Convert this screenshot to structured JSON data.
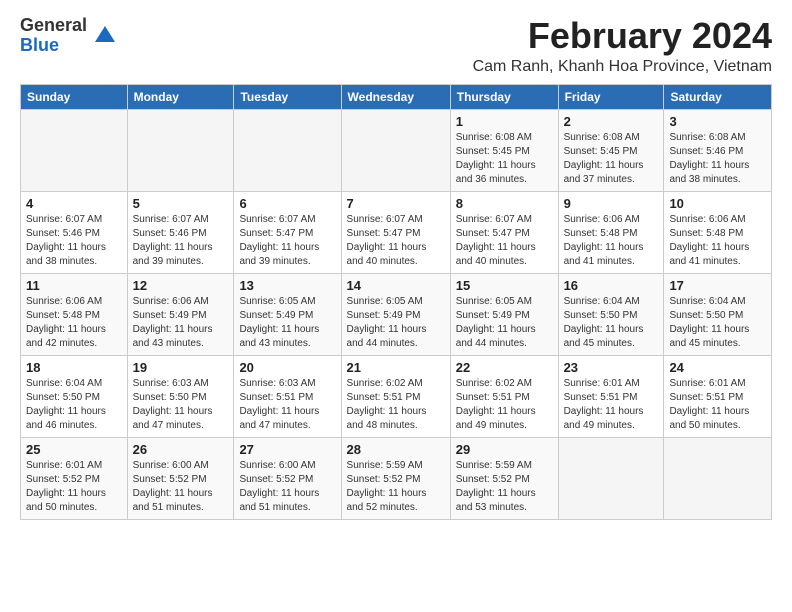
{
  "logo": {
    "general": "General",
    "blue": "Blue"
  },
  "title": "February 2024",
  "subtitle": "Cam Ranh, Khanh Hoa Province, Vietnam",
  "headers": [
    "Sunday",
    "Monday",
    "Tuesday",
    "Wednesday",
    "Thursday",
    "Friday",
    "Saturday"
  ],
  "weeks": [
    [
      {
        "day": "",
        "info": ""
      },
      {
        "day": "",
        "info": ""
      },
      {
        "day": "",
        "info": ""
      },
      {
        "day": "",
        "info": ""
      },
      {
        "day": "1",
        "info": "Sunrise: 6:08 AM\nSunset: 5:45 PM\nDaylight: 11 hours and 36 minutes."
      },
      {
        "day": "2",
        "info": "Sunrise: 6:08 AM\nSunset: 5:45 PM\nDaylight: 11 hours and 37 minutes."
      },
      {
        "day": "3",
        "info": "Sunrise: 6:08 AM\nSunset: 5:46 PM\nDaylight: 11 hours and 38 minutes."
      }
    ],
    [
      {
        "day": "4",
        "info": "Sunrise: 6:07 AM\nSunset: 5:46 PM\nDaylight: 11 hours and 38 minutes."
      },
      {
        "day": "5",
        "info": "Sunrise: 6:07 AM\nSunset: 5:46 PM\nDaylight: 11 hours and 39 minutes."
      },
      {
        "day": "6",
        "info": "Sunrise: 6:07 AM\nSunset: 5:47 PM\nDaylight: 11 hours and 39 minutes."
      },
      {
        "day": "7",
        "info": "Sunrise: 6:07 AM\nSunset: 5:47 PM\nDaylight: 11 hours and 40 minutes."
      },
      {
        "day": "8",
        "info": "Sunrise: 6:07 AM\nSunset: 5:47 PM\nDaylight: 11 hours and 40 minutes."
      },
      {
        "day": "9",
        "info": "Sunrise: 6:06 AM\nSunset: 5:48 PM\nDaylight: 11 hours and 41 minutes."
      },
      {
        "day": "10",
        "info": "Sunrise: 6:06 AM\nSunset: 5:48 PM\nDaylight: 11 hours and 41 minutes."
      }
    ],
    [
      {
        "day": "11",
        "info": "Sunrise: 6:06 AM\nSunset: 5:48 PM\nDaylight: 11 hours and 42 minutes."
      },
      {
        "day": "12",
        "info": "Sunrise: 6:06 AM\nSunset: 5:49 PM\nDaylight: 11 hours and 43 minutes."
      },
      {
        "day": "13",
        "info": "Sunrise: 6:05 AM\nSunset: 5:49 PM\nDaylight: 11 hours and 43 minutes."
      },
      {
        "day": "14",
        "info": "Sunrise: 6:05 AM\nSunset: 5:49 PM\nDaylight: 11 hours and 44 minutes."
      },
      {
        "day": "15",
        "info": "Sunrise: 6:05 AM\nSunset: 5:49 PM\nDaylight: 11 hours and 44 minutes."
      },
      {
        "day": "16",
        "info": "Sunrise: 6:04 AM\nSunset: 5:50 PM\nDaylight: 11 hours and 45 minutes."
      },
      {
        "day": "17",
        "info": "Sunrise: 6:04 AM\nSunset: 5:50 PM\nDaylight: 11 hours and 45 minutes."
      }
    ],
    [
      {
        "day": "18",
        "info": "Sunrise: 6:04 AM\nSunset: 5:50 PM\nDaylight: 11 hours and 46 minutes."
      },
      {
        "day": "19",
        "info": "Sunrise: 6:03 AM\nSunset: 5:50 PM\nDaylight: 11 hours and 47 minutes."
      },
      {
        "day": "20",
        "info": "Sunrise: 6:03 AM\nSunset: 5:51 PM\nDaylight: 11 hours and 47 minutes."
      },
      {
        "day": "21",
        "info": "Sunrise: 6:02 AM\nSunset: 5:51 PM\nDaylight: 11 hours and 48 minutes."
      },
      {
        "day": "22",
        "info": "Sunrise: 6:02 AM\nSunset: 5:51 PM\nDaylight: 11 hours and 49 minutes."
      },
      {
        "day": "23",
        "info": "Sunrise: 6:01 AM\nSunset: 5:51 PM\nDaylight: 11 hours and 49 minutes."
      },
      {
        "day": "24",
        "info": "Sunrise: 6:01 AM\nSunset: 5:51 PM\nDaylight: 11 hours and 50 minutes."
      }
    ],
    [
      {
        "day": "25",
        "info": "Sunrise: 6:01 AM\nSunset: 5:52 PM\nDaylight: 11 hours and 50 minutes."
      },
      {
        "day": "26",
        "info": "Sunrise: 6:00 AM\nSunset: 5:52 PM\nDaylight: 11 hours and 51 minutes."
      },
      {
        "day": "27",
        "info": "Sunrise: 6:00 AM\nSunset: 5:52 PM\nDaylight: 11 hours and 51 minutes."
      },
      {
        "day": "28",
        "info": "Sunrise: 5:59 AM\nSunset: 5:52 PM\nDaylight: 11 hours and 52 minutes."
      },
      {
        "day": "29",
        "info": "Sunrise: 5:59 AM\nSunset: 5:52 PM\nDaylight: 11 hours and 53 minutes."
      },
      {
        "day": "",
        "info": ""
      },
      {
        "day": "",
        "info": ""
      }
    ]
  ]
}
